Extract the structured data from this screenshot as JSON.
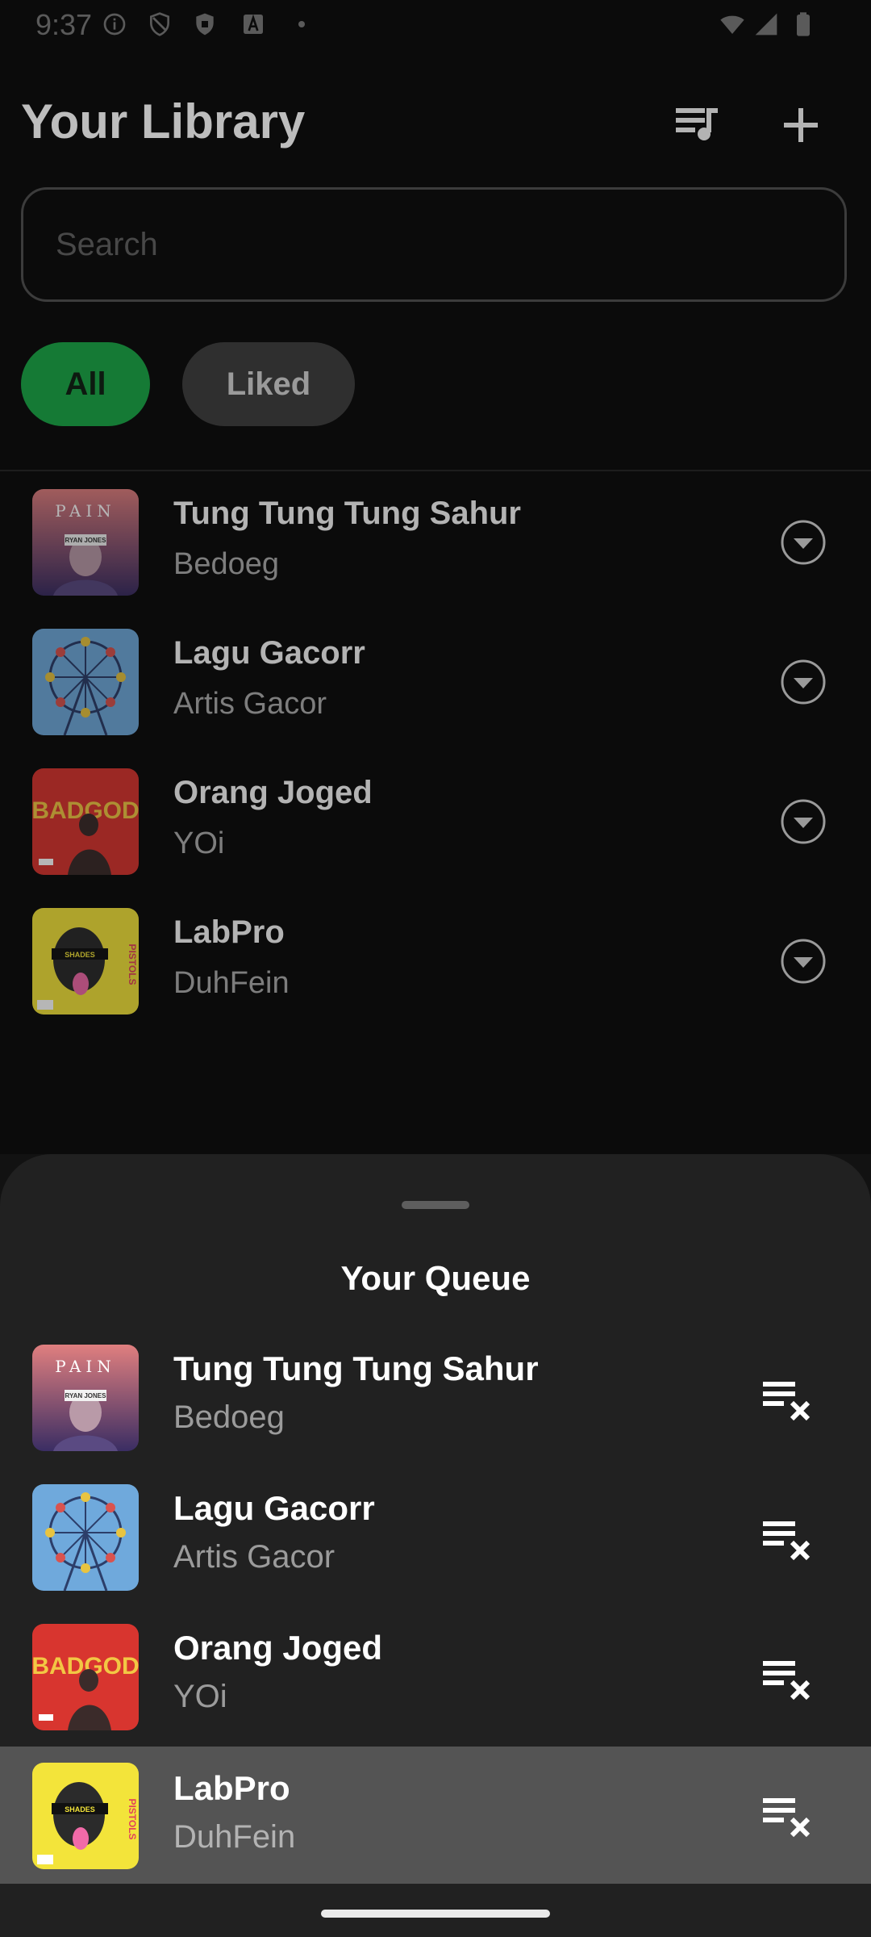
{
  "status": {
    "time": "9:37",
    "icons": [
      "info-icon",
      "shield-icon",
      "shield-filled-icon",
      "font-icon",
      "dot-icon",
      "wifi-icon",
      "signal-icon",
      "battery-icon"
    ]
  },
  "header": {
    "title": "Your Library",
    "queue_icon": "queue-music-icon",
    "add_icon": "plus-icon"
  },
  "search": {
    "placeholder": "Search",
    "value": ""
  },
  "filters": {
    "all": "All",
    "liked": "Liked",
    "selected": "All"
  },
  "library": [
    {
      "title": "Tung Tung Tung Sahur",
      "artist": "Bedoeg"
    },
    {
      "title": "Lagu Gacorr",
      "artist": "Artis Gacor"
    },
    {
      "title": "Orang Joged",
      "artist": "YOi"
    },
    {
      "title": "LabPro",
      "artist": "DuhFein"
    }
  ],
  "art_text": {
    "pain": "PAIN",
    "ryan": "RYAN JONES",
    "badgod": "BADGOD",
    "shades": "SHADES",
    "pistols": "PISTOLS"
  },
  "queue": {
    "title": "Your Queue",
    "items": [
      {
        "title": "Tung Tung Tung Sahur",
        "artist": "Bedoeg"
      },
      {
        "title": "Lagu Gacorr",
        "artist": "Artis Gacor"
      },
      {
        "title": "Orang Joged",
        "artist": "YOi"
      },
      {
        "title": "LabPro",
        "artist": "DuhFein",
        "highlighted": true
      }
    ]
  },
  "colors": {
    "background": "#121212",
    "accent_green": "#157a35",
    "sheet": "#212121",
    "highlight_row": "#545454"
  }
}
